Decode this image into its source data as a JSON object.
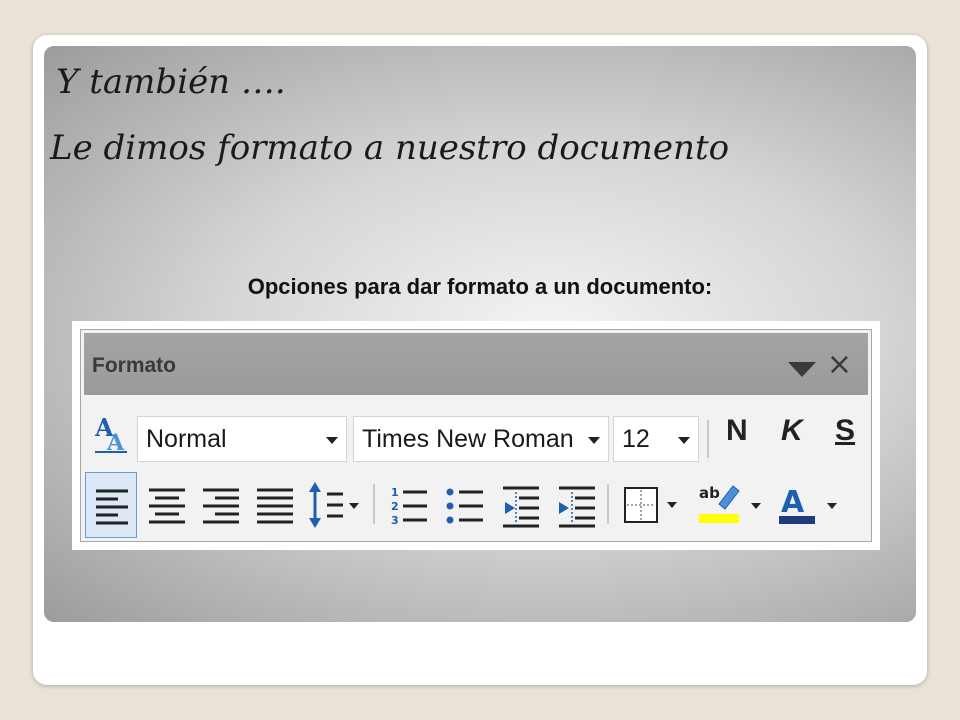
{
  "slide": {
    "title_line1": "Y también ….",
    "title_line2": "Le dimos formato a nuestro documento",
    "caption": "Opciones para dar formato a un documento:"
  },
  "toolbar": {
    "title": "Formato",
    "close_glyph": "×",
    "style_value": "Normal",
    "font_value": "Times New Roman",
    "size_value": "12",
    "bold_label": "N",
    "italic_label": "K",
    "strike_label": "S",
    "highlight_color": "#ffff00",
    "font_color": "#1f3c7a"
  },
  "icons": [
    "styles-icon",
    "dropdown-arrow-icon",
    "close-icon",
    "align-left-icon",
    "align-center-icon",
    "align-right-icon",
    "justify-icon",
    "line-spacing-icon",
    "numbered-list-icon",
    "bullet-list-icon",
    "decrease-indent-icon",
    "increase-indent-icon",
    "borders-icon",
    "highlight-icon",
    "font-color-icon"
  ]
}
